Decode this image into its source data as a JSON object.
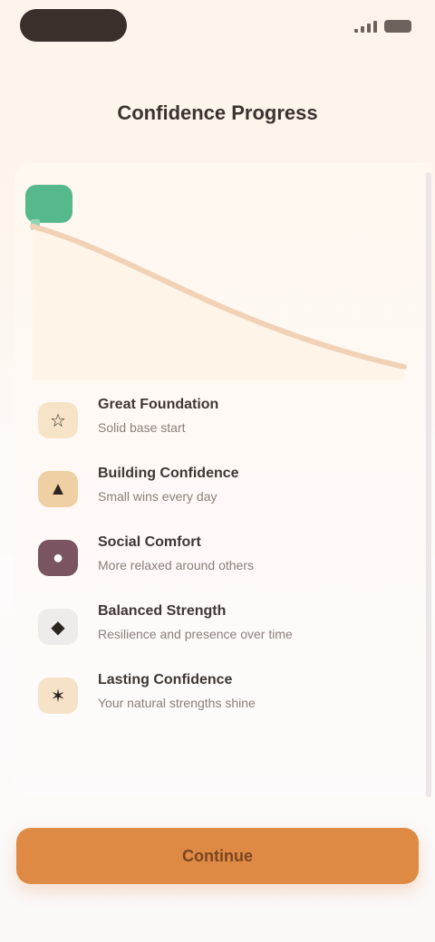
{
  "header": {
    "title": "Confidence Progress"
  },
  "status": {
    "icons": [
      "signal-icon",
      "battery-icon"
    ]
  },
  "chart": {
    "line_color": "#f2d2b6"
  },
  "items": [
    {
      "title": "Great Foundation",
      "subtitle": "Solid base start",
      "icon": "shield-icon",
      "icon_bg": "#f7e4c6",
      "icon_glyph": "☆"
    },
    {
      "title": "Building Confidence",
      "subtitle": "Small wins every day",
      "icon": "arrow-up-icon",
      "icon_bg": "#efcfa4",
      "icon_glyph": "▲"
    },
    {
      "title": "Social Comfort",
      "subtitle": "More relaxed around others",
      "icon": "people-icon",
      "icon_bg": "#7a5561",
      "icon_glyph": "●"
    },
    {
      "title": "Balanced Strength",
      "subtitle": "Resilience and presence over time",
      "icon": "balance-icon",
      "icon_bg": "#f0ebeb",
      "icon_glyph": "◆"
    },
    {
      "title": "Lasting Confidence",
      "subtitle": "Your natural strengths shine",
      "icon": "sun-icon",
      "icon_bg": "#f6e2c6",
      "icon_glyph": "✶"
    }
  ],
  "cta": {
    "label": "Continue"
  },
  "colors": {
    "accent": "#de8a44",
    "badge": "#55b98c"
  }
}
